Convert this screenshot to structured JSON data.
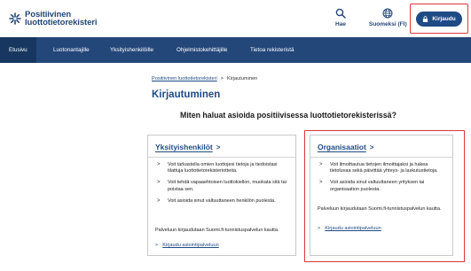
{
  "header": {
    "logo_line1": "Positiivinen",
    "logo_line2": "luottotietorekisteri",
    "search_label": "Hae",
    "language_label": "Suomeksi (FI)",
    "login_label": "Kirjaudu"
  },
  "nav": {
    "items": [
      {
        "label": "Etusivu"
      },
      {
        "label": "Luotonantajille"
      },
      {
        "label": "Yksityishenkilöille"
      },
      {
        "label": "Ohjelmistokehittäjille"
      },
      {
        "label": "Tietoa rekisteristä"
      }
    ]
  },
  "breadcrumb": {
    "home": "Positiivinen luottotietorekisteri",
    "separator": ">",
    "current": "Kirjautuminen"
  },
  "page_title": "Kirjautuminen",
  "question": "Miten haluat asioida positiivisessa luottotietorekisterissä?",
  "individual_card": {
    "title": "Yksityishenkilöt",
    "chevron": ">",
    "items": [
      "Voit tarkastella omien luottojesi tietoja ja tiedoistasi tilattuja luottotietorekisteriotteita.",
      "Voit tehdä vapaaehtoisen luottokiellon, muokata sitä tai poistaa sen.",
      "Voit asioida sinut valtuuttaneen henkilön puolesta."
    ],
    "note": "Palveluun kirjaudutaan Suomi.fi-tunnistuspalvelun kautta.",
    "link_text": "Kirjaudu asiointipalveluun"
  },
  "organization_card": {
    "title": "Organisaatiot",
    "chevron": ">",
    "items": [
      "Voit ilmoittautua tietojen ilmoittajaksi ja hakea tietoluvaa sekä päivittää yhteys- ja laskutustietoja.",
      "Voit asioida sinut valtuuttaneen yrityksen tai organisaation puolesta."
    ],
    "note": "Palveluun kirjaudutaan Suomi.fi-tunnistuspalvelun kautta.",
    "link_text": "Kirjaudu asiointipalveluun"
  },
  "bullet_glyph": ">",
  "colors": {
    "brand_blue": "#24477a",
    "button_blue": "#1f4b85",
    "highlight_red": "#d9373a"
  }
}
